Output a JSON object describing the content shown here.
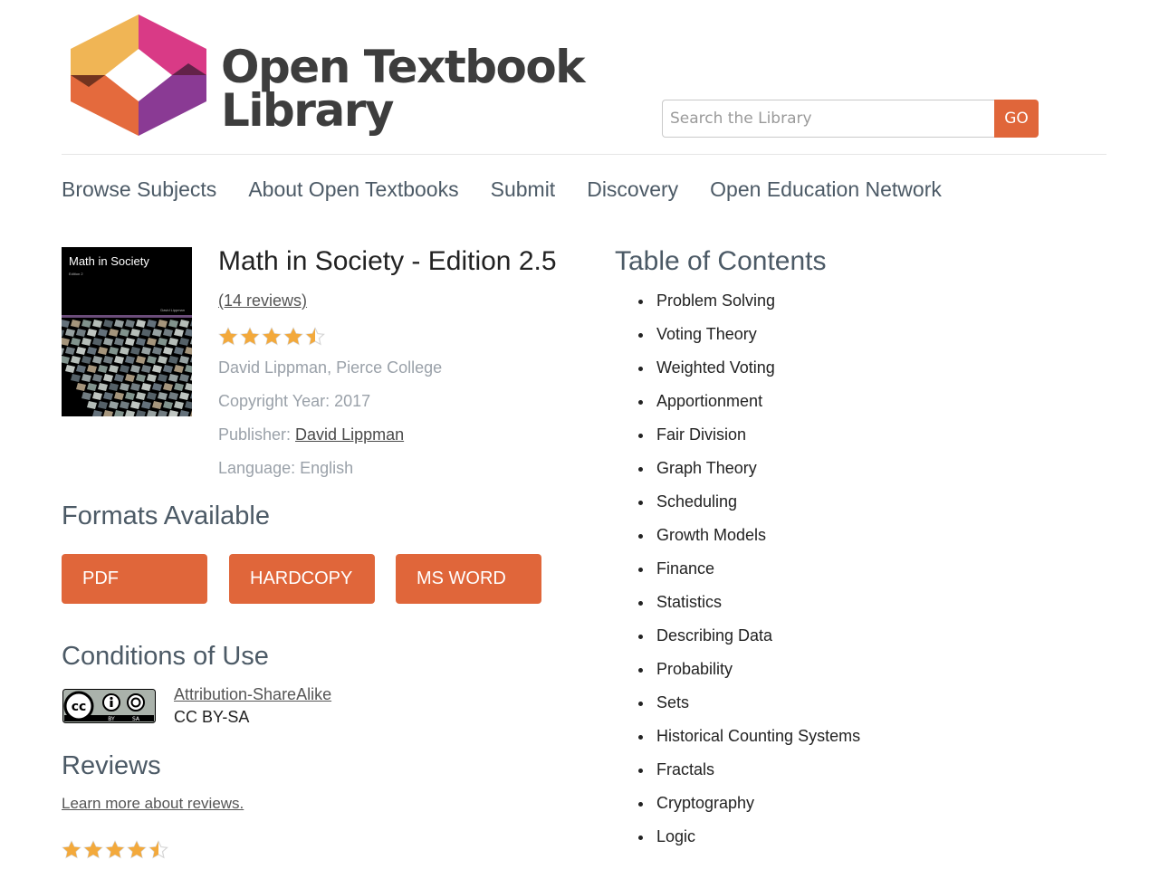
{
  "header": {
    "brand_line1": "Open Textbook",
    "brand_line2": "Library",
    "search": {
      "placeholder": "Search the Library",
      "button_label": "GO"
    }
  },
  "nav": {
    "items": [
      {
        "label": "Browse Subjects"
      },
      {
        "label": "About Open Textbooks"
      },
      {
        "label": "Submit"
      },
      {
        "label": "Discovery"
      },
      {
        "label": "Open Education Network"
      }
    ]
  },
  "book": {
    "cover_title": "Math in Society",
    "cover_edition": "Edition 2",
    "cover_author": "David Lippman",
    "title": "Math in Society - Edition 2.5",
    "reviews_link": "(14 reviews)",
    "rating": 4.5,
    "rating_max": 5,
    "author": "David Lippman, Pierce College",
    "copyright": "Copyright Year: 2017",
    "publisher_label": "Publisher: ",
    "publisher_name": "David Lippman",
    "language": "Language: English"
  },
  "formats": {
    "title": "Formats Available",
    "buttons": [
      "PDF",
      "HARDCOPY",
      "MS WORD"
    ]
  },
  "conditions": {
    "title": "Conditions of Use",
    "badge_text": [
      "cc",
      "BY",
      "SA"
    ],
    "license_link": "Attribution-ShareAlike",
    "license_code": "CC BY-SA"
  },
  "reviews": {
    "title": "Reviews",
    "learn_link": "Learn more about reviews.",
    "rating": 4.5
  },
  "toc": {
    "title": "Table of Contents",
    "items": [
      "Problem Solving",
      "Voting Theory",
      "Weighted Voting",
      "Apportionment",
      "Fair Division",
      "Graph Theory",
      "Scheduling",
      "Growth Models",
      "Finance",
      "Statistics",
      "Describing Data",
      "Probability",
      "Sets",
      "Historical Counting Systems",
      "Fractals",
      "Cryptography",
      "Logic"
    ]
  },
  "colors": {
    "accent": "#e0663a",
    "star": "#f3a93b",
    "star_empty": "#d6d6d6",
    "heading": "#4c5a66",
    "muted": "#9aa1a9"
  }
}
